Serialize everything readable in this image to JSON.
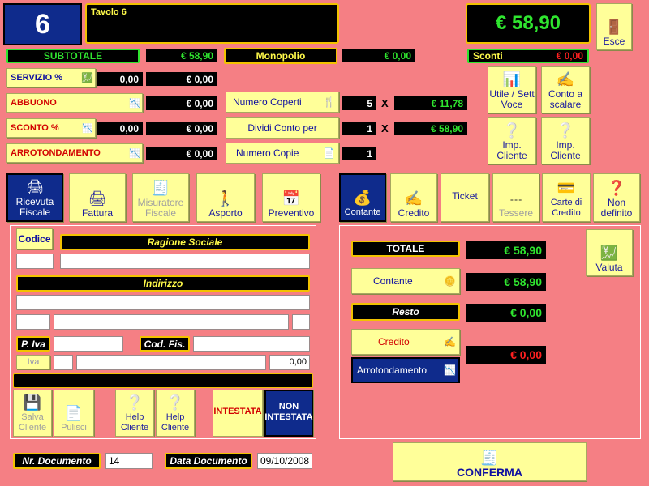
{
  "table_number": "6",
  "table_name": "Tavolo 6",
  "total_display": "€ 58,90",
  "exit_label": "Esce",
  "subtotale": {
    "label": "SUBTOTALE",
    "value": "€ 58,90"
  },
  "monopolio": {
    "label": "Monopolio",
    "value": "€ 0,00"
  },
  "sconti": {
    "label": "Sconti",
    "value": "€ 0,00"
  },
  "servizio": {
    "label": "SERVIZIO %",
    "pct": "0,00",
    "value": "€ 0,00"
  },
  "abbuono": {
    "label": "ABBUONO",
    "value": "€ 0,00"
  },
  "sconto": {
    "label": "SCONTO %",
    "pct": "0,00",
    "value": "€ 0,00"
  },
  "arrotondamento": {
    "label": "ARROTONDAMENTO",
    "value": "€ 0,00"
  },
  "coperti": {
    "label": "Numero Coperti",
    "count": "5",
    "x": "X",
    "value": "€ 11,78"
  },
  "dividi": {
    "label": "Dividi Conto per",
    "count": "1",
    "x": "X",
    "value": "€ 58,90"
  },
  "copie": {
    "label": "Numero Copie",
    "count": "1"
  },
  "right_buttons": {
    "utile": "Utile / Sett Voce",
    "conto_scalare": "Conto a scalare",
    "imp_cliente_1": "Imp. Cliente",
    "imp_cliente_2": "Imp. Cliente"
  },
  "doc_types": [
    "Ricevuta Fiscale",
    "Fattura",
    "Misuratore Fiscale",
    "Asporto",
    "Preventivo"
  ],
  "pay_types": [
    "Contante",
    "Credito",
    "Ticket",
    "Tessere",
    "Carte di Credito",
    "Non definito"
  ],
  "customer": {
    "codice_label": "Codice",
    "ragione_label": "Ragione Sociale",
    "indirizzo_label": "Indirizzo",
    "piva_label": "P. Iva",
    "codfis_label": "Cod. Fis.",
    "iva_label": "Iva",
    "iva_value": "0,00"
  },
  "bottom_buttons": {
    "salva": "Salva Cliente",
    "pulisci": "Pulisci",
    "help1": "Help Cliente",
    "help2": "Help Cliente",
    "intestata": "INTESTATA",
    "non_intestata": "NON INTESTATA"
  },
  "payment": {
    "totale_label": "TOTALE",
    "totale_value": "€ 58,90",
    "contante_label": "Contante",
    "contante_value": "€ 58,90",
    "resto_label": "Resto",
    "resto_value": "€ 0,00",
    "credito_label": "Credito",
    "credito_value": "€ 0,00",
    "arrot_label": "Arrotondamento",
    "valuta_label": "Valuta"
  },
  "documento": {
    "nr_label": "Nr. Documento",
    "nr_value": "14",
    "data_label": "Data Documento",
    "data_value": "09/10/2008"
  },
  "confirm_label": "CONFERMA"
}
